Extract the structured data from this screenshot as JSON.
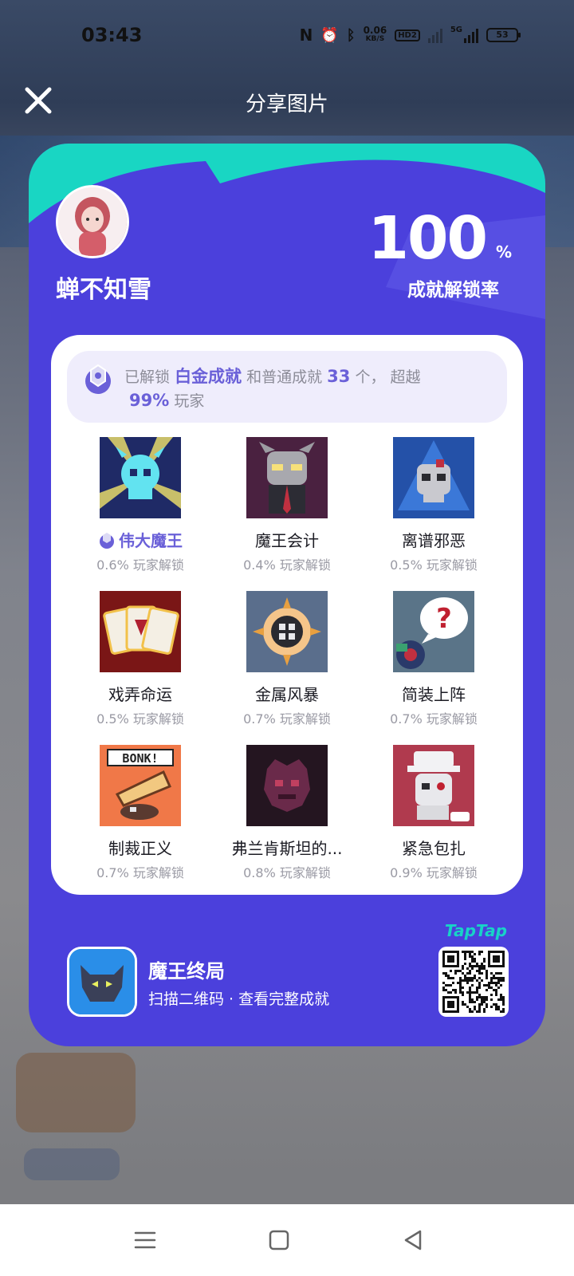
{
  "status_bar": {
    "time": "03:43",
    "net_speed_value": "0.06",
    "net_speed_unit": "KB/S",
    "hd_label": "HD2",
    "signal_5g": "5G",
    "battery": "53"
  },
  "header": {
    "title": "分享图片",
    "close_icon": "close-icon"
  },
  "card": {
    "username": "蝉不知雪",
    "rate_value": "100",
    "rate_percent": "%",
    "rate_label": "成就解锁率",
    "summary": {
      "prefix": "已解锁",
      "platinum": "白金成就",
      "middle": "和普通成就",
      "count": "33",
      "count_suffix": "个，",
      "surpass": "超越",
      "percent": "99%",
      "players": "玩家"
    },
    "achievements": [
      {
        "name": "伟大魔王",
        "pct": "0.6% 玩家解锁",
        "highlight": true
      },
      {
        "name": "魔王会计",
        "pct": "0.4% 玩家解锁"
      },
      {
        "name": "离谱邪恶",
        "pct": "0.5% 玩家解锁"
      },
      {
        "name": "戏弄命运",
        "pct": "0.5% 玩家解锁"
      },
      {
        "name": "金属风暴",
        "pct": "0.7% 玩家解锁"
      },
      {
        "name": "简装上阵",
        "pct": "0.7% 玩家解锁"
      },
      {
        "name": "制裁正义",
        "pct": "0.7% 玩家解锁"
      },
      {
        "name": "弗兰肯斯坦的...",
        "pct": "0.8% 玩家解锁"
      },
      {
        "name": "紧急包扎",
        "pct": "0.9% 玩家解锁"
      }
    ],
    "footer": {
      "app_name": "魔王终局",
      "app_sub": "扫描二维码 · 查看完整成就",
      "brand": "TapTap"
    }
  },
  "colors": {
    "card_bg": "#4b40dc",
    "card_accent": "#19d6c3",
    "highlight": "#6a60d8"
  }
}
